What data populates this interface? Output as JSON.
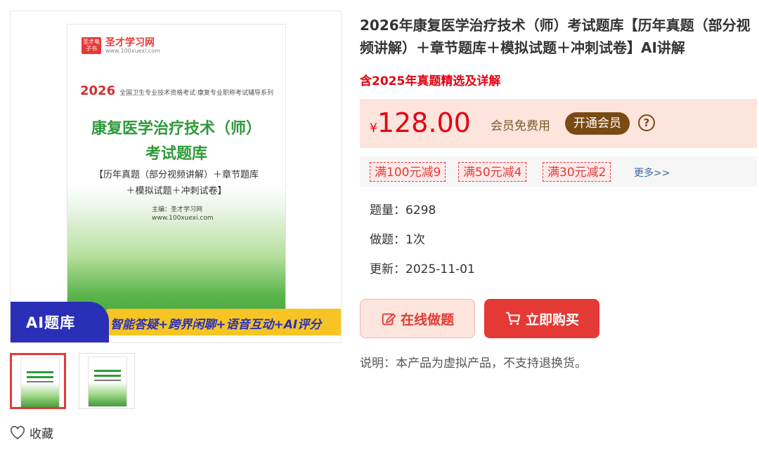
{
  "product": {
    "title": "2026年康复医学治疗技术（师）考试题库【历年真题（部分视频讲解）＋章节题库＋模拟试题＋冲刺试卷】AI讲解",
    "subtitle": "含2025年真题精选及详解",
    "price_currency": "¥",
    "price": "128.00",
    "member_free": "会员免费用",
    "member_button": "开通会员",
    "help_icon": "?",
    "coupons": [
      "满100元减9",
      "满50元减4",
      "满30元减2"
    ],
    "more": "更多>>",
    "stats": [
      {
        "label": "题量：",
        "value": "6298"
      },
      {
        "label": "做题：",
        "value": "1次"
      },
      {
        "label": "更新：",
        "value": "2025-11-01"
      }
    ],
    "online_button": "在线做题",
    "buy_button": "立即购买",
    "note": "说明：本产品为虚拟产品，不支持退换货。",
    "favorite": "收藏"
  },
  "cover": {
    "brand": "圣才学习网",
    "brand_mark": "圣才电子书",
    "brand_url": "www.100xuexi.com",
    "year": "2026",
    "series": "全国卫生专业技术资格考试·康复专业职称考试辅导系列",
    "title_line1": "康复医学治疗技术（师）",
    "title_line2": "考试题库",
    "title_line3": "【历年真题（部分视频讲解）＋章节题库",
    "title_line4": "＋模拟试题＋冲刺试卷】",
    "editor": "主编：圣才学习网",
    "editor_url": "www.100xuexi.com",
    "banner_left": "AI题库",
    "banner_right": "智能答疑+跨界闲聊+语音互动+AI评分"
  },
  "colors": {
    "accent_red": "#e60012",
    "price_bg": "#fde4dc",
    "member_brown": "#7a4a14",
    "cover_green": "#2e9a3a",
    "banner_blue": "#2a2fb8",
    "banner_yellow": "#f6c524"
  }
}
